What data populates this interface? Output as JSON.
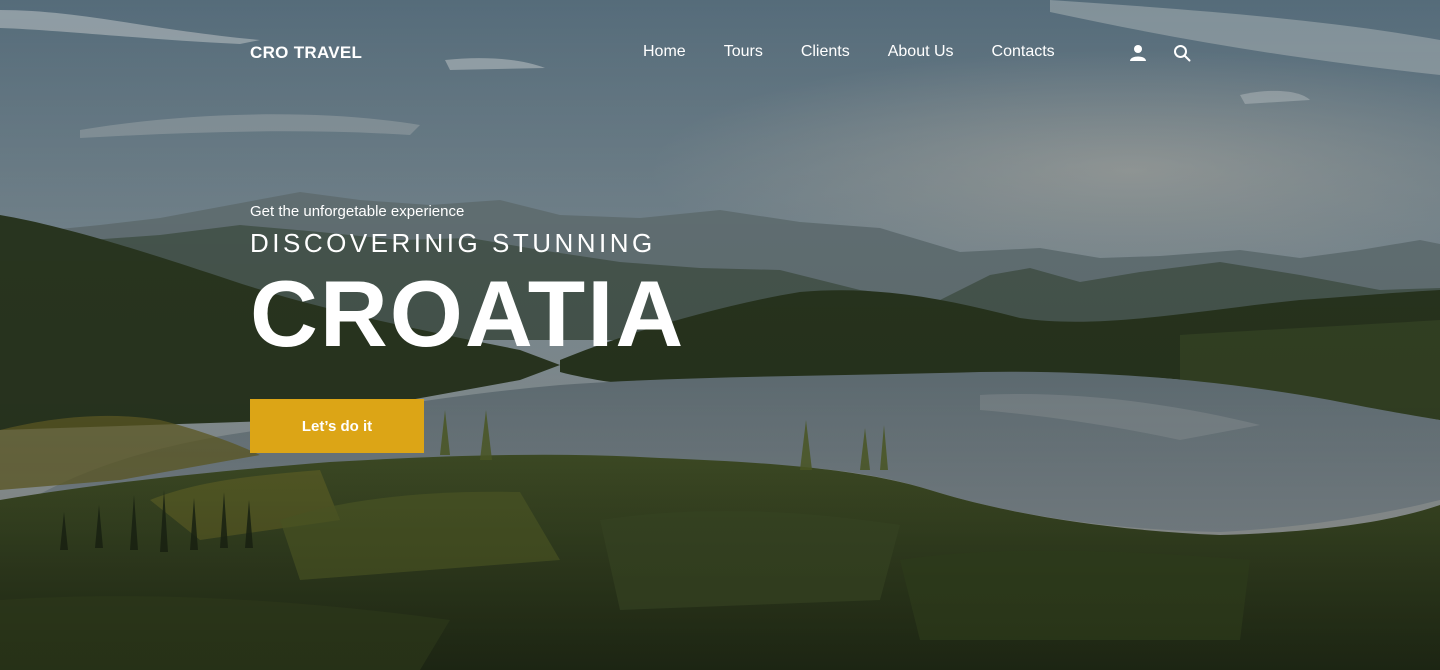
{
  "brand": {
    "name": "CRO TRAVEL"
  },
  "nav": {
    "items": [
      {
        "label": "Home"
      },
      {
        "label": "Tours"
      },
      {
        "label": "Clients"
      },
      {
        "label": "About Us"
      },
      {
        "label": "Contacts"
      }
    ],
    "icons": [
      "user-icon",
      "search-icon"
    ]
  },
  "hero": {
    "tagline": "Get the unforgetable experience",
    "subtitle": "DISCOVERINIG STUNNING",
    "headline": "CROATIA",
    "cta_label": "Let’s do it"
  },
  "colors": {
    "accent": "#dca516",
    "text": "#ffffff"
  }
}
